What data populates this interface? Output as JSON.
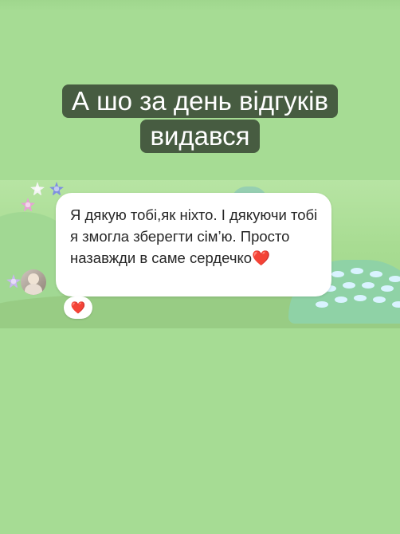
{
  "caption": {
    "line1": "А шо за день відгуків",
    "line2": "видався"
  },
  "message": {
    "text": "Я дякую тобі,як ніхто. І дякуючи тобі я змогла зберегти сім’ю. Просто назавжди в саме сердечко❤️"
  },
  "reaction": {
    "emoji": "❤️"
  },
  "colors": {
    "background": "#a6dc94",
    "caption_bg": "#3a4a36",
    "bubble": "#ffffff"
  }
}
